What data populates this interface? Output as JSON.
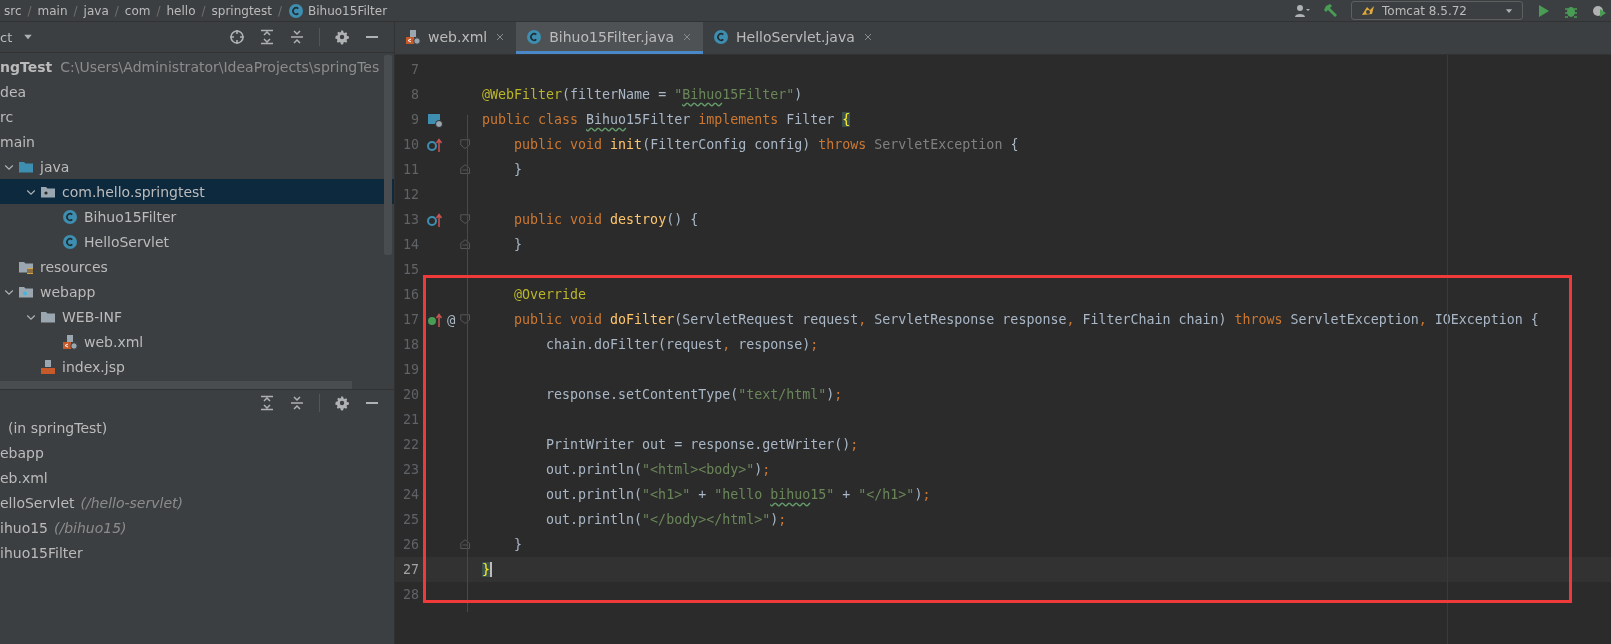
{
  "breadcrumbs": [
    {
      "label": "src"
    },
    {
      "label": "main",
      "separator": "/"
    },
    {
      "label": "java",
      "separator": "/"
    },
    {
      "label": "com",
      "separator": "/"
    },
    {
      "label": "hello",
      "separator": "/"
    },
    {
      "label": "springtest",
      "separator": "/"
    },
    {
      "label": "Bihuo15Filter",
      "kind": "class",
      "separator": "/"
    }
  ],
  "run_config": {
    "label": "Tomcat 8.5.72"
  },
  "project_panel": {
    "title": "ct"
  },
  "project_tree": [
    {
      "label": "ngTest",
      "path": "C:\\Users\\Administrator\\IdeaProjects\\springTes",
      "selected": false,
      "children": [
        {
          "label": "dea",
          "selected": false
        },
        {
          "label": "rc",
          "selected": false,
          "children": [
            {
              "label": "main",
              "selected": false,
              "children": [
                {
                  "label": "java",
                  "kind": "source_folder",
                  "expanded": true,
                  "selected": false,
                  "children": [
                    {
                      "label": "com.hello.springtest",
                      "kind": "package",
                      "expanded": true,
                      "selected": true,
                      "children": [
                        {
                          "label": "Bihuo15Filter",
                          "kind": "class",
                          "selected": false
                        },
                        {
                          "label": "HelloServlet",
                          "kind": "class",
                          "selected": false
                        }
                      ]
                    }
                  ]
                },
                {
                  "label": "resources",
                  "kind": "resources",
                  "selected": false
                },
                {
                  "label": "webapp",
                  "kind": "web_folder",
                  "expanded": true,
                  "selected": false,
                  "children": [
                    {
                      "label": "WEB-INF",
                      "kind": "folder",
                      "expanded": true,
                      "selected": false,
                      "children": [
                        {
                          "label": "web.xml",
                          "kind": "xml",
                          "selected": false
                        }
                      ]
                    },
                    {
                      "label": "index.jsp",
                      "kind": "jsp",
                      "selected": false
                    }
                  ]
                }
              ]
            }
          ]
        }
      ]
    }
  ],
  "web_tree": [
    {
      "label": "(in springTest)"
    },
    {
      "label": "ebapp"
    },
    {
      "label": "eb.xml"
    },
    {
      "label": "elloServlet",
      "detail": "(/hello-servlet)"
    },
    {
      "label": "ihuo15",
      "detail": "(/bihuo15)"
    },
    {
      "label": "ihuo15Filter"
    }
  ],
  "editor_tabs": [
    {
      "label": "web.xml",
      "kind": "xml",
      "selected": false
    },
    {
      "label": "Bihuo15Filter.java",
      "kind": "class",
      "selected": true
    },
    {
      "label": "HelloServlet.java",
      "kind": "class",
      "selected": false
    }
  ],
  "lines": [
    {
      "number": "7",
      "current": false
    },
    {
      "number": "8",
      "current": false,
      "tokens": [
        {
          "t": "@WebFilter",
          "kind": "ann"
        },
        {
          "t": "(filterName = ",
          "kind": "txt"
        },
        {
          "t": "\"",
          "kind": "str"
        },
        {
          "t": "Bihuo",
          "kind": "str_typo"
        },
        {
          "t": "15Filter\"",
          "kind": "str"
        },
        {
          "t": ")",
          "kind": "txt"
        }
      ]
    },
    {
      "number": "9",
      "current": false,
      "marker": {
        "kind": "web_class"
      },
      "tokens": [
        {
          "t": "public class ",
          "kind": "kw"
        },
        {
          "t": "Bihuo",
          "kind": "txt_typo"
        },
        {
          "t": "15Filter ",
          "kind": "txt"
        },
        {
          "t": "implements ",
          "kind": "kw"
        },
        {
          "t": "Filter ",
          "kind": "txt"
        },
        {
          "t": "{",
          "kind": "brace_match"
        }
      ]
    },
    {
      "number": "10",
      "current": false,
      "marker": {
        "kind": "override"
      },
      "fold": {
        "kind": "start"
      },
      "tokens": [
        {
          "t": "    public void ",
          "kind": "kw"
        },
        {
          "t": "init",
          "kind": "fn"
        },
        {
          "t": "(FilterConfig config) ",
          "kind": "txt"
        },
        {
          "t": "throws ",
          "kind": "kw"
        },
        {
          "t": "ServletException",
          "kind": "dim"
        },
        {
          "t": " {",
          "kind": "txt"
        }
      ]
    },
    {
      "number": "11",
      "current": false,
      "fold": {
        "kind": "end"
      },
      "tokens": [
        {
          "t": "    }",
          "kind": "txt"
        }
      ]
    },
    {
      "number": "12",
      "current": false
    },
    {
      "number": "13",
      "current": false,
      "marker": {
        "kind": "override"
      },
      "fold": {
        "kind": "start"
      },
      "tokens": [
        {
          "t": "    public void ",
          "kind": "kw"
        },
        {
          "t": "destroy",
          "kind": "fn"
        },
        {
          "t": "() {",
          "kind": "txt"
        }
      ]
    },
    {
      "number": "14",
      "current": false,
      "fold": {
        "kind": "end"
      },
      "tokens": [
        {
          "t": "    }",
          "kind": "txt"
        }
      ]
    },
    {
      "number": "15",
      "current": false
    },
    {
      "number": "16",
      "current": false,
      "tokens": [
        {
          "t": "    @Override",
          "kind": "ann"
        }
      ]
    },
    {
      "number": "17",
      "current": false,
      "marker": {
        "kind": "implements"
      },
      "gutter_text": "@",
      "fold": {
        "kind": "start"
      },
      "tokens": [
        {
          "t": "    public void ",
          "kind": "kw"
        },
        {
          "t": "doFilter",
          "kind": "fn"
        },
        {
          "t": "(ServletRequest request",
          "kind": "txt"
        },
        {
          "t": ", ",
          "kind": "punct"
        },
        {
          "t": "ServletResponse response",
          "kind": "txt"
        },
        {
          "t": ", ",
          "kind": "punct"
        },
        {
          "t": "FilterChain chain) ",
          "kind": "txt"
        },
        {
          "t": "throws ",
          "kind": "kw"
        },
        {
          "t": "ServletException",
          "kind": "txt"
        },
        {
          "t": ", ",
          "kind": "punct"
        },
        {
          "t": "IOException {",
          "kind": "txt"
        }
      ]
    },
    {
      "number": "18",
      "current": false,
      "tokens": [
        {
          "t": "        chain.doFilter(request",
          "kind": "txt"
        },
        {
          "t": ", ",
          "kind": "punct"
        },
        {
          "t": "response)",
          "kind": "txt"
        },
        {
          "t": ";",
          "kind": "punct"
        }
      ]
    },
    {
      "number": "19",
      "current": false
    },
    {
      "number": "20",
      "current": false,
      "tokens": [
        {
          "t": "        response.setContentType(",
          "kind": "txt"
        },
        {
          "t": "\"text/html\"",
          "kind": "str"
        },
        {
          "t": ")",
          "kind": "txt"
        },
        {
          "t": ";",
          "kind": "punct"
        }
      ]
    },
    {
      "number": "21",
      "current": false
    },
    {
      "number": "22",
      "current": false,
      "tokens": [
        {
          "t": "        PrintWriter out = response.getWriter()",
          "kind": "txt"
        },
        {
          "t": ";",
          "kind": "punct"
        }
      ]
    },
    {
      "number": "23",
      "current": false,
      "tokens": [
        {
          "t": "        out.println(",
          "kind": "txt"
        },
        {
          "t": "\"<html><body>\"",
          "kind": "str"
        },
        {
          "t": ")",
          "kind": "txt"
        },
        {
          "t": ";",
          "kind": "punct"
        }
      ]
    },
    {
      "number": "24",
      "current": false,
      "tokens": [
        {
          "t": "        out.println(",
          "kind": "txt"
        },
        {
          "t": "\"<h1>\"",
          "kind": "str"
        },
        {
          "t": " + ",
          "kind": "txt"
        },
        {
          "t": "\"hello ",
          "kind": "str"
        },
        {
          "t": "bihuo",
          "kind": "str_typo"
        },
        {
          "t": "15\"",
          "kind": "str"
        },
        {
          "t": " + ",
          "kind": "txt"
        },
        {
          "t": "\"</h1>\"",
          "kind": "str"
        },
        {
          "t": ")",
          "kind": "txt"
        },
        {
          "t": ";",
          "kind": "punct"
        }
      ]
    },
    {
      "number": "25",
      "current": false,
      "tokens": [
        {
          "t": "        out.println(",
          "kind": "txt"
        },
        {
          "t": "\"</body></html>\"",
          "kind": "str"
        },
        {
          "t": ")",
          "kind": "txt"
        },
        {
          "t": ";",
          "kind": "punct"
        }
      ]
    },
    {
      "number": "26",
      "current": false,
      "fold": {
        "kind": "end"
      },
      "tokens": [
        {
          "t": "    }",
          "kind": "txt"
        }
      ]
    },
    {
      "number": "27",
      "current": true,
      "tokens": [
        {
          "t": "}",
          "kind": "brace_caret"
        }
      ]
    },
    {
      "number": "28",
      "current": false
    }
  ]
}
